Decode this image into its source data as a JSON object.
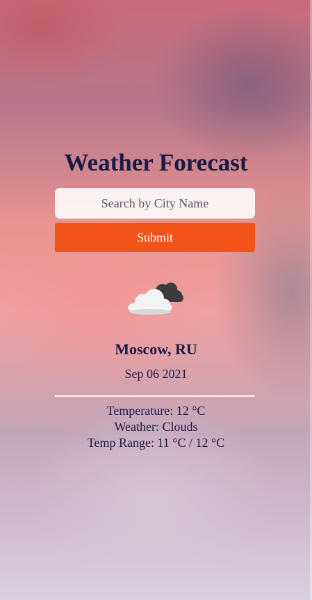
{
  "header": {
    "title": "Weather Forecast"
  },
  "search": {
    "placeholder": "Search by City Name",
    "value": ""
  },
  "actions": {
    "submit_label": "Submit"
  },
  "current": {
    "icon": "clouds-icon",
    "location": "Moscow, RU",
    "date": "Sep 06 2021",
    "temperature": "Temperature: 12 °C",
    "weather": "Weather: Clouds",
    "temp_range": "Temp Range: 11 °C / 12 °C"
  },
  "colors": {
    "text": "#1b1a45",
    "accent_button": "#f25318",
    "input_background": "#ffffff"
  }
}
